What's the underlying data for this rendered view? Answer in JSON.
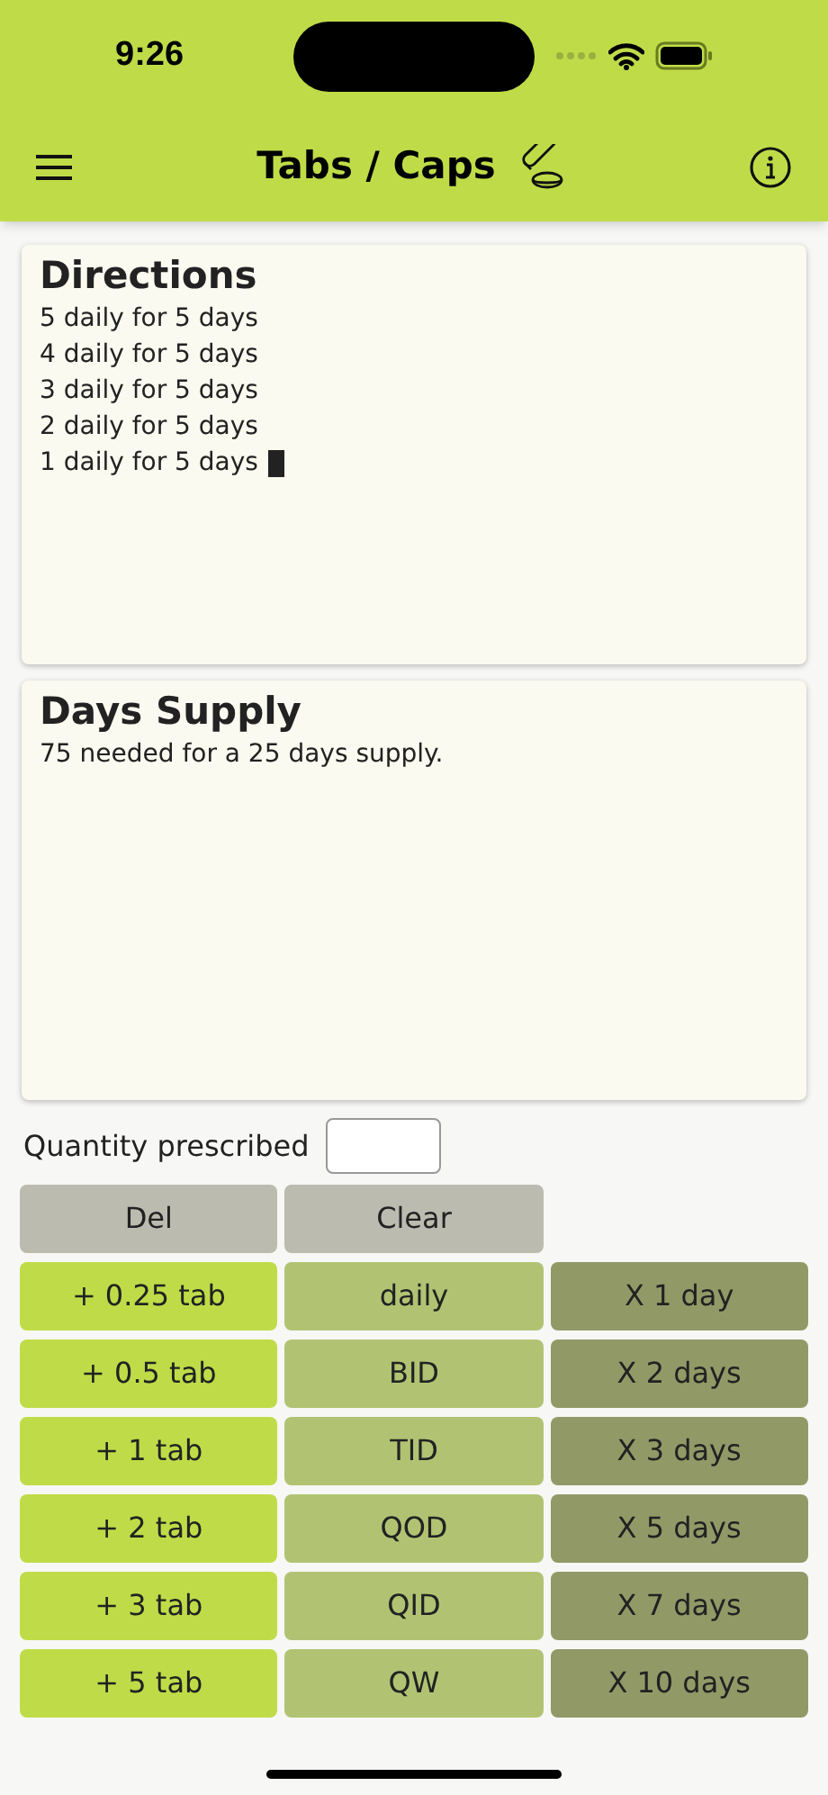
{
  "status_bar": {
    "time": "9:26"
  },
  "header": {
    "title": "Tabs / Caps"
  },
  "directions": {
    "heading": "Directions",
    "lines": [
      "5 daily for 5 days",
      "4 daily for 5 days",
      "3 daily for 5 days",
      "2 daily for 5 days",
      "1 daily for 5 days"
    ],
    "cursor": true
  },
  "days_supply": {
    "heading": "Days Supply",
    "text": "75 needed for a 25 days supply."
  },
  "quantity": {
    "label": "Quantity prescribed"
  },
  "keypad": [
    [
      {
        "label": "Del",
        "kind": "action"
      },
      {
        "label": "Clear",
        "kind": "action"
      }
    ],
    [
      {
        "label": "+ 0.25 tab",
        "kind": "amount"
      },
      {
        "label": "daily",
        "kind": "frequency"
      },
      {
        "label": "X 1 day",
        "kind": "duration"
      }
    ],
    [
      {
        "label": "+ 0.5 tab",
        "kind": "amount"
      },
      {
        "label": "BID",
        "kind": "frequency"
      },
      {
        "label": "X 2 days",
        "kind": "duration"
      }
    ],
    [
      {
        "label": "+ 1 tab",
        "kind": "amount"
      },
      {
        "label": "TID",
        "kind": "frequency"
      },
      {
        "label": "X 3 days",
        "kind": "duration"
      }
    ],
    [
      {
        "label": "+ 2 tab",
        "kind": "amount"
      },
      {
        "label": "QOD",
        "kind": "frequency"
      },
      {
        "label": "X 5 days",
        "kind": "duration"
      }
    ],
    [
      {
        "label": "+ 3 tab",
        "kind": "amount"
      },
      {
        "label": "QID",
        "kind": "frequency"
      },
      {
        "label": "X 7 days",
        "kind": "duration"
      }
    ],
    [
      {
        "label": "+ 5 tab",
        "kind": "amount"
      },
      {
        "label": "QW",
        "kind": "frequency"
      },
      {
        "label": "X 10 days",
        "kind": "duration"
      }
    ]
  ]
}
